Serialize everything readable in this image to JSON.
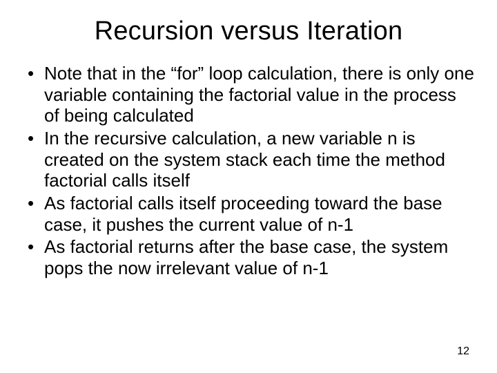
{
  "title": "Recursion versus Iteration",
  "bullets": [
    "Note that in the “for” loop calculation, there is only one variable containing the factorial value in the process of being calculated",
    "In the recursive calculation, a new variable n is created on the system stack each time the method factorial calls itself",
    "As factorial calls itself proceeding toward the base case, it pushes the current value of n-1",
    "As factorial returns after the base case, the system pops the now irrelevant value of n-1"
  ],
  "page_number": "12"
}
